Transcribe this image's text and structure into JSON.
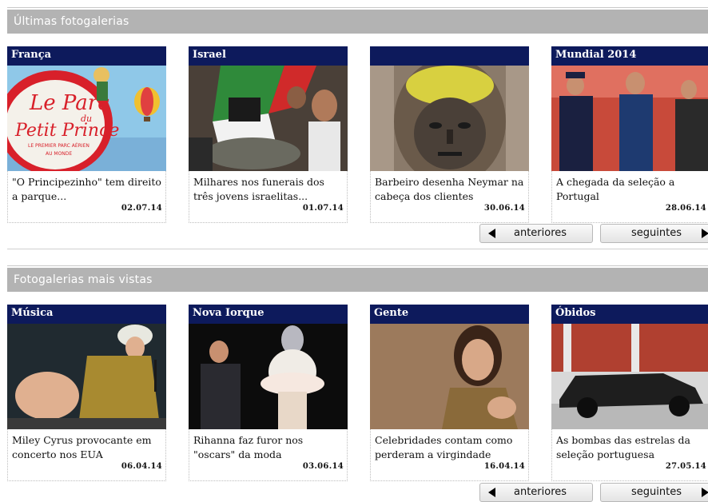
{
  "sections": [
    {
      "title": "Últimas fotogalerias",
      "cards": [
        {
          "category": "França",
          "caption": "\"O Principezinho\" tem direito a parque...",
          "date": "02.07.14",
          "image": "le-parc-du-petit-prince-sign"
        },
        {
          "category": "Israel",
          "caption": "Milhares nos funerais dos três jovens israelitas...",
          "date": "01.07.14",
          "image": "funeral-crowd-with-flags"
        },
        {
          "category": "",
          "caption": "Barbeiro desenha Neymar na cabeça dos clientes",
          "date": "30.06.14",
          "image": "neymar-haircut-art"
        },
        {
          "category": "Mundial 2014",
          "caption": "A chegada da seleção a Portugal",
          "date": "28.06.14",
          "image": "team-arrival-with-police"
        }
      ],
      "prev_label": "anteriores",
      "next_label": "seguintes"
    },
    {
      "title": "Fotogalerias mais vistas",
      "cards": [
        {
          "category": "Música",
          "caption": "Miley Cyrus provocante em concerto nos EUA",
          "date": "06.04.14",
          "image": "singer-on-stage"
        },
        {
          "category": "Nova Iorque",
          "caption": "Rihanna faz furor nos \"oscars\" da moda",
          "date": "03.06.14",
          "image": "rihanna-at-gala"
        },
        {
          "category": "Gente",
          "caption": "Celebridades contam como perderam a virgindade",
          "date": "16.04.14",
          "image": "celebrity-portrait"
        },
        {
          "category": "Óbidos",
          "caption": "As bombas das estrelas da seleção portuguesa",
          "date": "27.05.14",
          "image": "black-sports-car"
        }
      ],
      "prev_label": "anteriores",
      "next_label": "seguintes"
    }
  ],
  "colors": {
    "header_bg": "#b3b3b3",
    "category_bg": "#0d1a5c",
    "header_text": "#ffffff"
  }
}
